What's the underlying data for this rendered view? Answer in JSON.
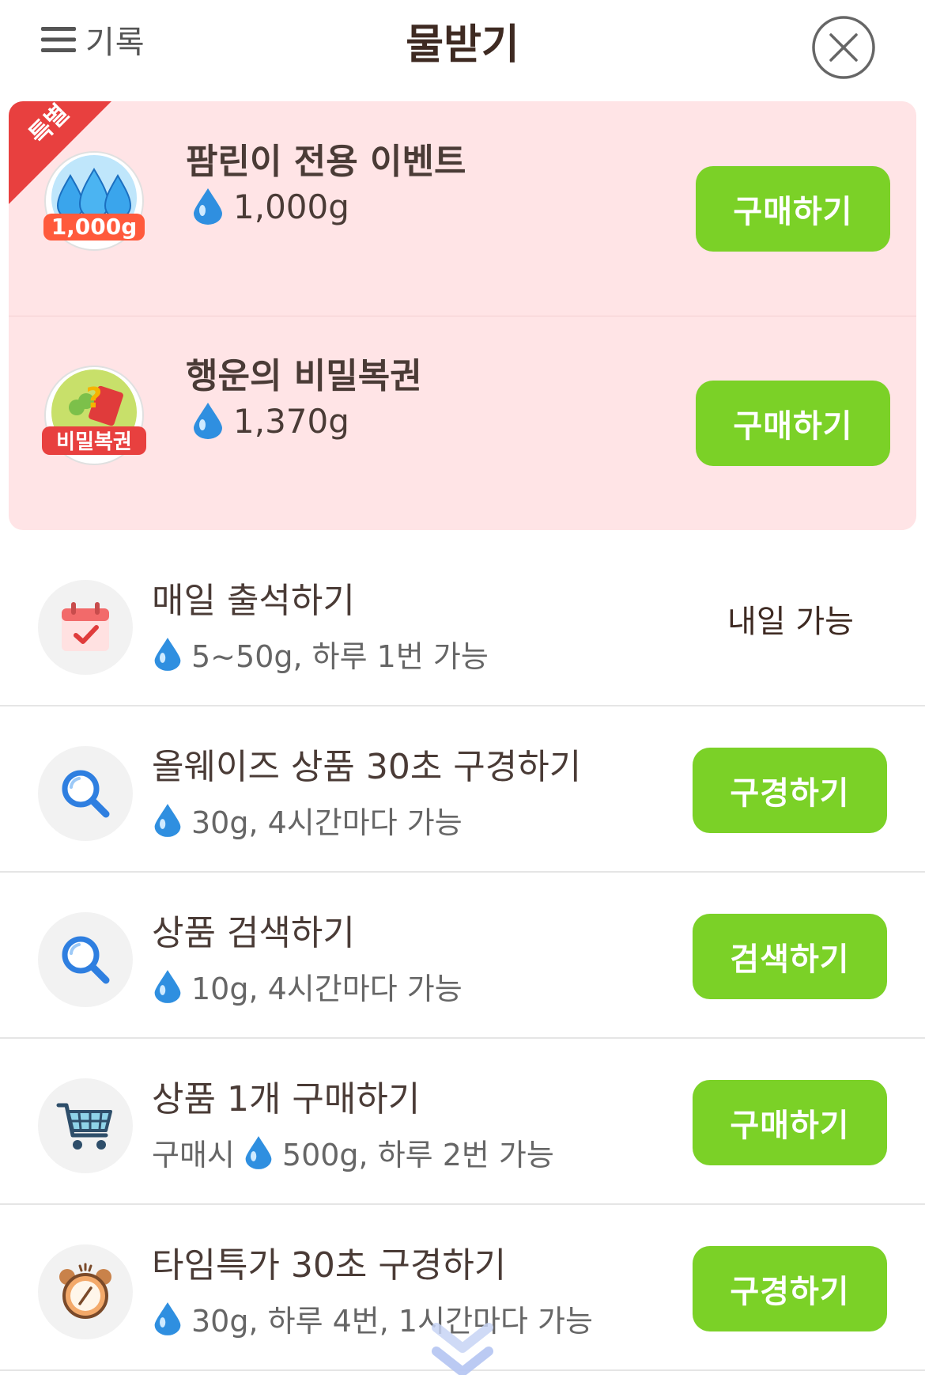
{
  "header": {
    "history_label": "기록",
    "title": "물받기"
  },
  "special": {
    "ribbon_label": "특별",
    "items": [
      {
        "badge_text": "1,000g",
        "title": "팜린이 전용 이벤트",
        "amount": "1,000g",
        "button": "구매하기"
      },
      {
        "badge_text": "비밀복권",
        "title": "행운의 비밀복권",
        "amount": "1,370g",
        "button": "구매하기"
      }
    ]
  },
  "tasks": [
    {
      "icon": "calendar-check-icon",
      "title": "매일 출석하기",
      "desc_prefix": "",
      "desc": "5~50g, 하루 1번 가능",
      "status": "내일 가능",
      "button": ""
    },
    {
      "icon": "magnifier-icon",
      "title": "올웨이즈 상품 30초 구경하기",
      "desc_prefix": "",
      "desc": "30g, 4시간마다 가능",
      "button": "구경하기"
    },
    {
      "icon": "magnifier-icon",
      "title": "상품 검색하기",
      "desc_prefix": "",
      "desc": "10g, 4시간마다 가능",
      "button": "검색하기"
    },
    {
      "icon": "shopping-cart-icon",
      "title": "상품 1개 구매하기",
      "desc_prefix": "구매시",
      "desc": "500g, 하루 2번 가능",
      "button": "구매하기"
    },
    {
      "icon": "alarm-clock-icon",
      "title": "타임특가 30초 구경하기",
      "desc_prefix": "",
      "desc": "30g, 하루 4번, 1시간마다 가능",
      "button": "구경하기"
    }
  ],
  "colors": {
    "accent_green": "#7bd127",
    "special_bg": "#ffe4e6",
    "ribbon_red": "#e8403f",
    "water_blue": "#2f8fe0"
  }
}
